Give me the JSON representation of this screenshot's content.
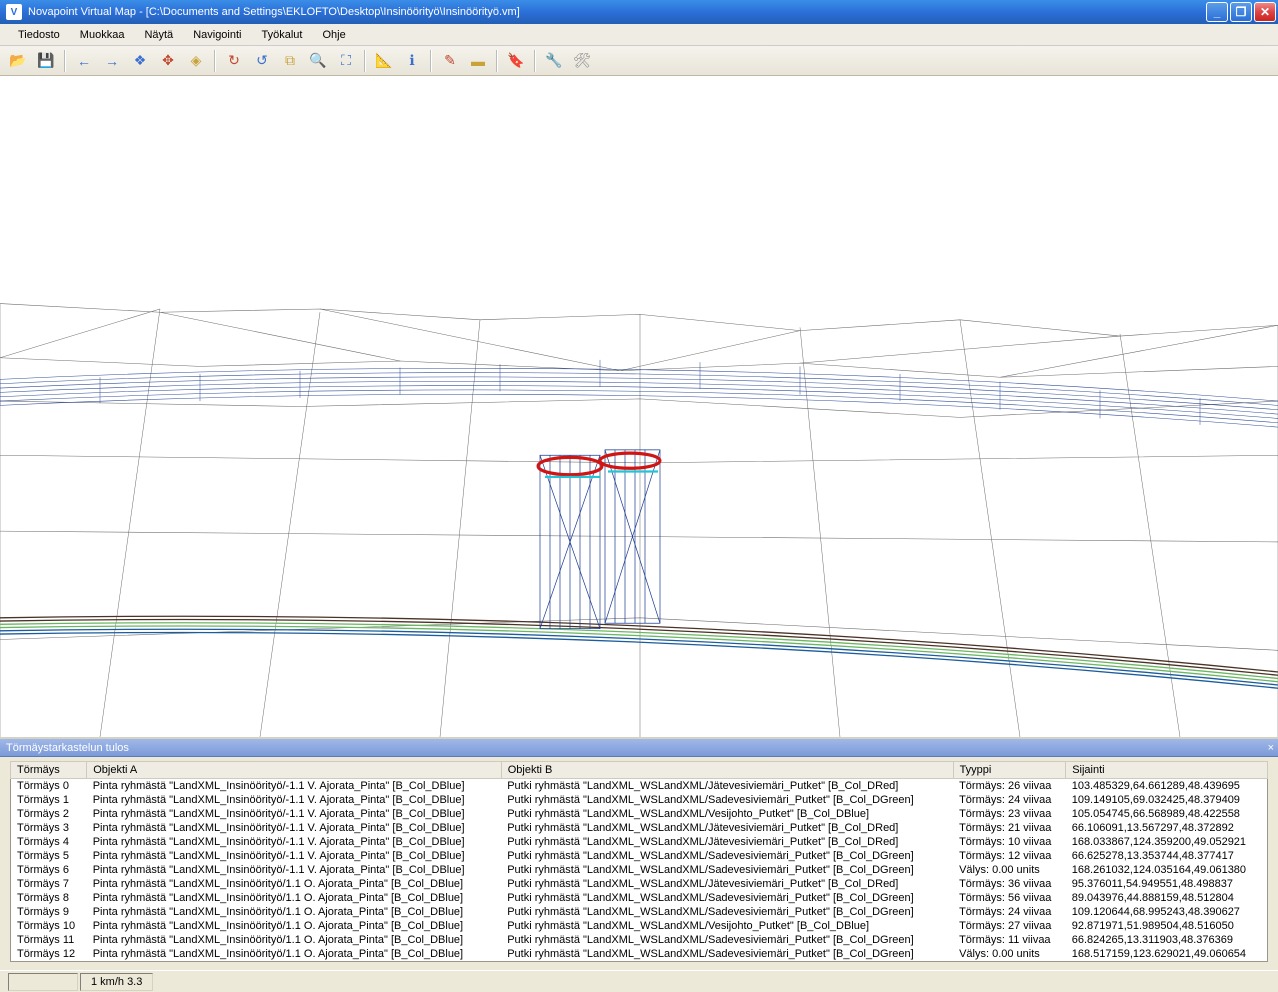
{
  "title": "Novapoint Virtual Map - [C:\\Documents and Settings\\EKLOFTO\\Desktop\\Insinöörityö\\Insinöörityö.vm]",
  "menu": {
    "items": [
      "Tiedosto",
      "Muokkaa",
      "Näytä",
      "Navigointi",
      "Työkalut",
      "Ohje"
    ]
  },
  "toolbar": {
    "icons": [
      {
        "name": "open",
        "glyph": "📂",
        "color": "#caa23a"
      },
      {
        "name": "save",
        "glyph": "💾",
        "color": "#caa23a"
      },
      {
        "name": "sep"
      },
      {
        "name": "back",
        "glyph": "←",
        "color": "#3a6fd0"
      },
      {
        "name": "forward",
        "glyph": "→",
        "color": "#3a6fd0"
      },
      {
        "name": "orbit",
        "glyph": "❖",
        "color": "#3a6fd0"
      },
      {
        "name": "pan",
        "glyph": "✥",
        "color": "#c1462e"
      },
      {
        "name": "walk",
        "glyph": "◈",
        "color": "#caa23a"
      },
      {
        "name": "sep"
      },
      {
        "name": "redo",
        "glyph": "↻",
        "color": "#c1462e"
      },
      {
        "name": "undo",
        "glyph": "↺",
        "color": "#3a6fd0"
      },
      {
        "name": "copy",
        "glyph": "⧉",
        "color": "#caa23a"
      },
      {
        "name": "zoom-in",
        "glyph": "🔍",
        "color": "#3a6fd0"
      },
      {
        "name": "zoom-fit",
        "glyph": "⛶",
        "color": "#3a6fd0"
      },
      {
        "name": "sep"
      },
      {
        "name": "measure",
        "glyph": "📐",
        "color": "#caa23a"
      },
      {
        "name": "info",
        "glyph": "ℹ",
        "color": "#3a6fd0"
      },
      {
        "name": "sep"
      },
      {
        "name": "brush",
        "glyph": "✎",
        "color": "#c1462e"
      },
      {
        "name": "erase",
        "glyph": "▬",
        "color": "#caa23a"
      },
      {
        "name": "sep"
      },
      {
        "name": "tag",
        "glyph": "🔖",
        "color": "#caa23a"
      },
      {
        "name": "sep"
      },
      {
        "name": "tool1",
        "glyph": "🔧",
        "color": "#888"
      },
      {
        "name": "tool2",
        "glyph": "🛠",
        "color": "#888"
      }
    ]
  },
  "panel": {
    "title": "Törmäystarkastelun tulos",
    "headers": [
      "Törmäys",
      "Objekti A",
      "Objekti B",
      "Tyyppi",
      "Sijainti"
    ],
    "rows": [
      {
        "c": "Törmäys 0",
        "a": "Pinta ryhmästä \"LandXML_Insinöörityö/-1.1 V. Ajorata_Pinta\" [B_Col_DBlue]",
        "b": "Putki ryhmästä \"LandXML_WSLandXML/Jätevesiviemäri_Putket\" [B_Col_DRed]",
        "t": "Törmäys: 26 viivaa",
        "s": "103.485329,64.661289,48.439695"
      },
      {
        "c": "Törmäys 1",
        "a": "Pinta ryhmästä \"LandXML_Insinöörityö/-1.1 V. Ajorata_Pinta\" [B_Col_DBlue]",
        "b": "Putki ryhmästä \"LandXML_WSLandXML/Sadevesiviemäri_Putket\" [B_Col_DGreen]",
        "t": "Törmäys: 24 viivaa",
        "s": "109.149105,69.032425,48.379409"
      },
      {
        "c": "Törmäys 2",
        "a": "Pinta ryhmästä \"LandXML_Insinöörityö/-1.1 V. Ajorata_Pinta\" [B_Col_DBlue]",
        "b": "Putki ryhmästä \"LandXML_WSLandXML/Vesijohto_Putket\" [B_Col_DBlue]",
        "t": "Törmäys: 23 viivaa",
        "s": "105.054745,66.568989,48.422558"
      },
      {
        "c": "Törmäys 3",
        "a": "Pinta ryhmästä \"LandXML_Insinöörityö/-1.1 V. Ajorata_Pinta\" [B_Col_DBlue]",
        "b": "Putki ryhmästä \"LandXML_WSLandXML/Jätevesiviemäri_Putket\" [B_Col_DRed]",
        "t": "Törmäys: 21 viivaa",
        "s": "66.106091,13.567297,48.372892"
      },
      {
        "c": "Törmäys 4",
        "a": "Pinta ryhmästä \"LandXML_Insinöörityö/-1.1 V. Ajorata_Pinta\" [B_Col_DBlue]",
        "b": "Putki ryhmästä \"LandXML_WSLandXML/Jätevesiviemäri_Putket\" [B_Col_DRed]",
        "t": "Törmäys: 10 viivaa",
        "s": "168.033867,124.359200,49.052921"
      },
      {
        "c": "Törmäys 5",
        "a": "Pinta ryhmästä \"LandXML_Insinöörityö/-1.1 V. Ajorata_Pinta\" [B_Col_DBlue]",
        "b": "Putki ryhmästä \"LandXML_WSLandXML/Sadevesiviemäri_Putket\" [B_Col_DGreen]",
        "t": "Törmäys: 12 viivaa",
        "s": "66.625278,13.353744,48.377417"
      },
      {
        "c": "Törmäys 6",
        "a": "Pinta ryhmästä \"LandXML_Insinöörityö/-1.1 V. Ajorata_Pinta\" [B_Col_DBlue]",
        "b": "Putki ryhmästä \"LandXML_WSLandXML/Sadevesiviemäri_Putket\" [B_Col_DGreen]",
        "t": "Välys: 0.00 units",
        "s": "168.261032,124.035164,49.061380"
      },
      {
        "c": "Törmäys 7",
        "a": "Pinta ryhmästä \"LandXML_Insinöörityö/1.1 O. Ajorata_Pinta\" [B_Col_DBlue]",
        "b": "Putki ryhmästä \"LandXML_WSLandXML/Jätevesiviemäri_Putket\" [B_Col_DRed]",
        "t": "Törmäys: 36 viivaa",
        "s": "95.376011,54.949551,48.498837"
      },
      {
        "c": "Törmäys 8",
        "a": "Pinta ryhmästä \"LandXML_Insinöörityö/1.1 O. Ajorata_Pinta\" [B_Col_DBlue]",
        "b": "Putki ryhmästä \"LandXML_WSLandXML/Sadevesiviemäri_Putket\" [B_Col_DGreen]",
        "t": "Törmäys: 56 viivaa",
        "s": "89.043976,44.888159,48.512804"
      },
      {
        "c": "Törmäys 9",
        "a": "Pinta ryhmästä \"LandXML_Insinöörityö/1.1 O. Ajorata_Pinta\" [B_Col_DBlue]",
        "b": "Putki ryhmästä \"LandXML_WSLandXML/Sadevesiviemäri_Putket\" [B_Col_DGreen]",
        "t": "Törmäys: 24 viivaa",
        "s": "109.120644,68.995243,48.390627"
      },
      {
        "c": "Törmäys 10",
        "a": "Pinta ryhmästä \"LandXML_Insinöörityö/1.1 O. Ajorata_Pinta\" [B_Col_DBlue]",
        "b": "Putki ryhmästä \"LandXML_WSLandXML/Vesijohto_Putket\" [B_Col_DBlue]",
        "t": "Törmäys: 27 viivaa",
        "s": "92.871971,51.989504,48.516050"
      },
      {
        "c": "Törmäys 11",
        "a": "Pinta ryhmästä \"LandXML_Insinöörityö/1.1 O. Ajorata_Pinta\" [B_Col_DBlue]",
        "b": "Putki ryhmästä \"LandXML_WSLandXML/Sadevesiviemäri_Putket\" [B_Col_DGreen]",
        "t": "Törmäys: 11 viivaa",
        "s": "66.824265,13.311903,48.376369"
      },
      {
        "c": "Törmäys 12",
        "a": "Pinta ryhmästä \"LandXML_Insinöörityö/1.1 O. Ajorata_Pinta\" [B_Col_DBlue]",
        "b": "Putki ryhmästä \"LandXML_WSLandXML/Sadevesiviemäri_Putket\" [B_Col_DGreen]",
        "t": "Välys: 0.00 units",
        "s": "168.517159,123.629021,49.060654"
      }
    ]
  },
  "statusbar": {
    "speed": "1 km/h  3.3"
  }
}
